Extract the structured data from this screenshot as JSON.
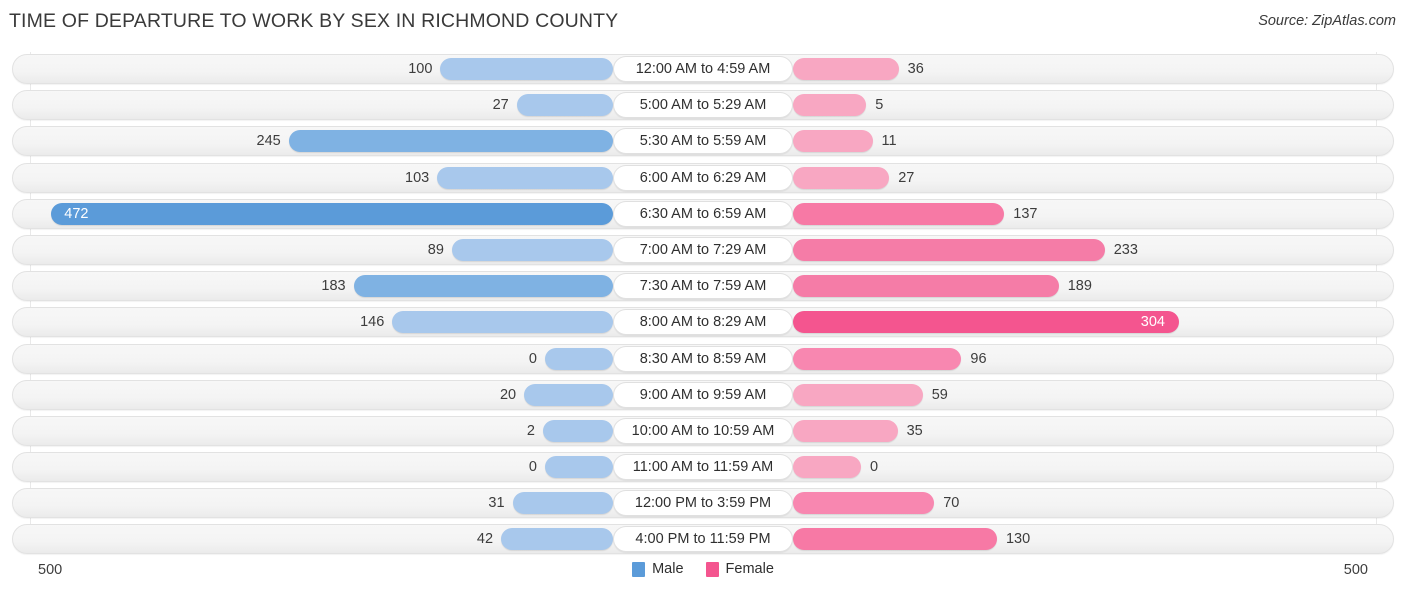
{
  "header": {
    "title": "TIME OF DEPARTURE TO WORK BY SEX IN RICHMOND COUNTY",
    "source": "Source: ZipAtlas.com"
  },
  "axis": {
    "left_max_label": "500",
    "right_max_label": "500",
    "max": 500
  },
  "legend": {
    "items": [
      {
        "label": "Male",
        "color": "#5b9bd9"
      },
      {
        "label": "Female",
        "color": "#f4558f"
      }
    ]
  },
  "colors": {
    "male_light": "#a8c8ec",
    "male_dark": "#5b9bd9",
    "female_light": "#f8a7c2",
    "female_mid": "#f57ca7",
    "female_dark": "#f4558f",
    "track": "#f4f4f4",
    "track_border": "#e2e2e2",
    "text": "#3d3d3d"
  },
  "chart_data": {
    "type": "bar",
    "subtype": "diverging-bidirectional",
    "title": "TIME OF DEPARTURE TO WORK BY SEX IN RICHMOND COUNTY",
    "xlabel": "",
    "ylabel": "",
    "xlim": [
      500,
      0,
      500
    ],
    "grid": false,
    "legend_position": "bottom-center",
    "categories": [
      "12:00 AM to 4:59 AM",
      "5:00 AM to 5:29 AM",
      "5:30 AM to 5:59 AM",
      "6:00 AM to 6:29 AM",
      "6:30 AM to 6:59 AM",
      "7:00 AM to 7:29 AM",
      "7:30 AM to 7:59 AM",
      "8:00 AM to 8:29 AM",
      "8:30 AM to 8:59 AM",
      "9:00 AM to 9:59 AM",
      "10:00 AM to 10:59 AM",
      "11:00 AM to 11:59 AM",
      "12:00 PM to 3:59 PM",
      "4:00 PM to 11:59 PM"
    ],
    "series": [
      {
        "name": "Male",
        "direction": "left",
        "color": "#5b9bd9",
        "values": [
          100,
          27,
          245,
          103,
          472,
          89,
          183,
          146,
          0,
          20,
          2,
          0,
          31,
          42
        ]
      },
      {
        "name": "Female",
        "direction": "right",
        "color": "#f4558f",
        "values": [
          36,
          5,
          11,
          27,
          137,
          233,
          189,
          304,
          96,
          59,
          35,
          0,
          70,
          130
        ]
      }
    ]
  }
}
